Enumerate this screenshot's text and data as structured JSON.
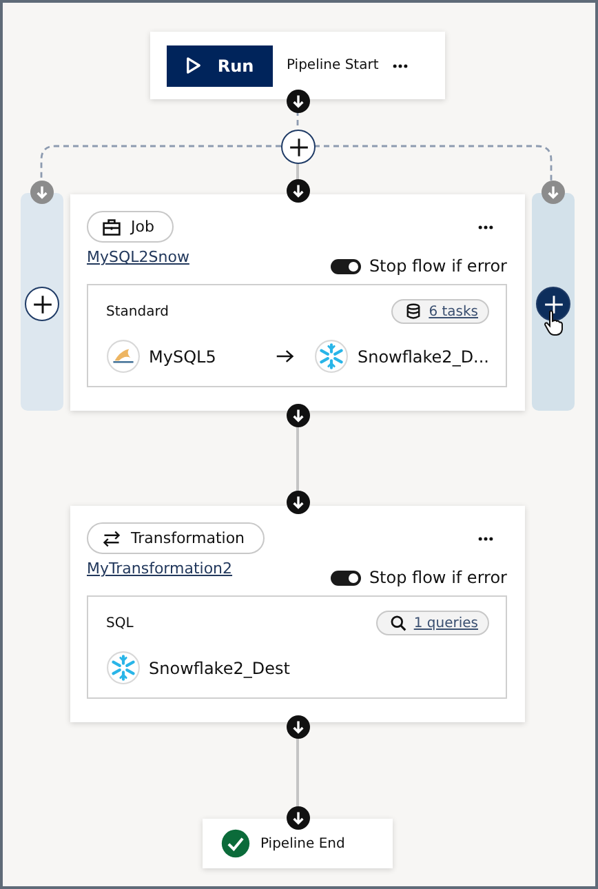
{
  "start": {
    "run_label": "Run",
    "title": "Pipeline Start"
  },
  "branches": [
    {
      "hovered": false
    },
    {
      "hovered": true
    }
  ],
  "steps": [
    {
      "kind": "job",
      "type_label": "Job",
      "name": "MySQL2Snow",
      "stop_on_error": true,
      "stop_label": "Stop flow if error",
      "detail": {
        "label": "Standard",
        "count": "6 tasks",
        "source": "MySQL5",
        "target": "Snowflake2_D..."
      }
    },
    {
      "kind": "transformation",
      "type_label": "Transformation",
      "name": "MyTransformation2",
      "stop_on_error": true,
      "stop_label": "Stop flow if error",
      "detail": {
        "label": "SQL",
        "count": "1 queries",
        "target": "Snowflake2_Dest"
      }
    }
  ],
  "end": {
    "label": "Pipeline End"
  }
}
